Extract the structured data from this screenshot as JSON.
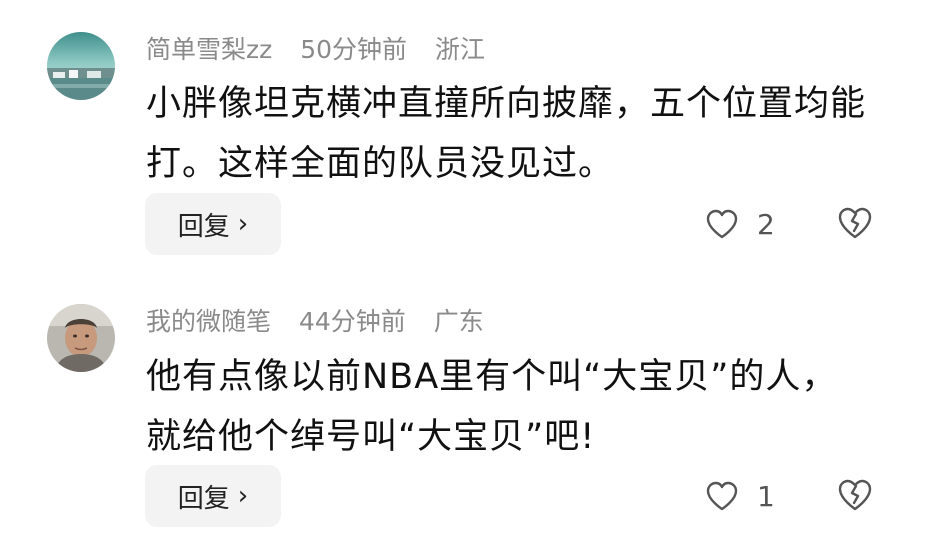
{
  "comments": [
    {
      "username": "简单雪梨zz",
      "time": "50分钟前",
      "location": "浙江",
      "text": "小胖像坦克横冲直撞所向披靡，五个位置均能打。这样全面的队员没见过。",
      "reply_label": "回复",
      "reply_chevron": "›",
      "likes": "2",
      "avatar": "landscape-avatar"
    },
    {
      "username": "我的微随笔",
      "time": "44分钟前",
      "location": "广东",
      "text": "他有点像以前NBA里有个叫“大宝贝”的人，就给他个绰号叫“大宝贝”吧!",
      "reply_label": "回复",
      "reply_chevron": "›",
      "likes": "1",
      "avatar": "portrait-avatar"
    }
  ],
  "icons": {
    "like": "heart-outline-icon",
    "dislike": "broken-heart-icon"
  },
  "colors": {
    "meta_text": "#8a8a8a",
    "body_text": "#111111",
    "reply_bg": "#f3f3f3",
    "icon_stroke": "#555555"
  }
}
